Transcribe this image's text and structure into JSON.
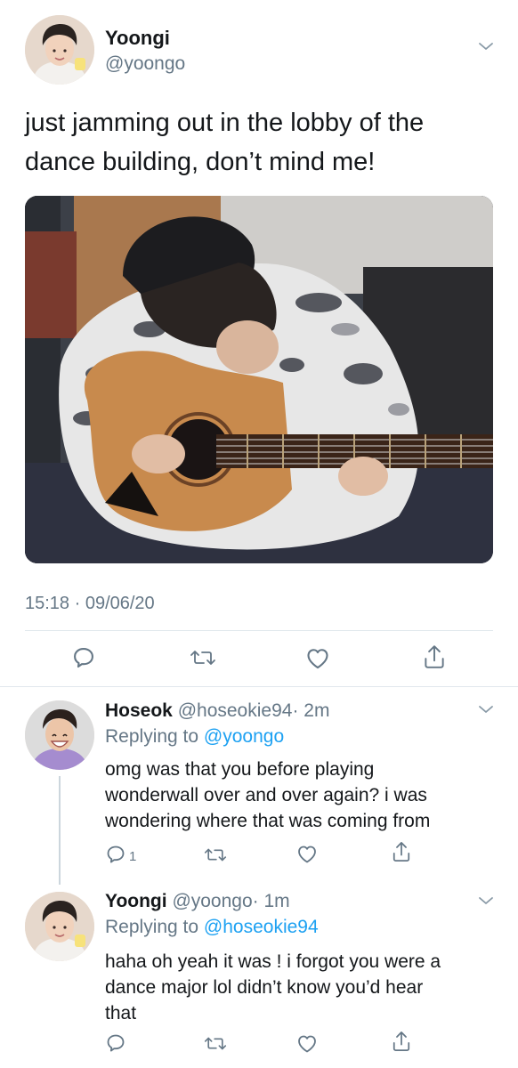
{
  "main_tweet": {
    "display_name": "Yoongi",
    "handle": "@yoongo",
    "text_line1": "just jamming out in the lobby of the",
    "text_line2": "dance building, don’t mind me!",
    "timestamp": "15:18 · 09/06/20",
    "avatar_icon": "person-avatar",
    "media_icon": "photo-guitar-player"
  },
  "replies": [
    {
      "display_name": "Hoseok",
      "handle": "@hoseokie94",
      "time": "· 2m",
      "replying_label": "Replying to",
      "replying_to": "@yoongo",
      "text_line1": "omg was that you before playing",
      "text_line2": "wonderwall over and over again? i was",
      "text_line3": "wondering where that was coming from",
      "reply_count": "1"
    },
    {
      "display_name": "Yoongi",
      "handle": "@yoongo",
      "time": "· 1m",
      "replying_label": "Replying to",
      "replying_to": "@hoseokie94",
      "text_line1": "haha oh yeah it was ! i forgot you were a",
      "text_line2": "dance major lol didn’t know you’d hear",
      "text_line3": "that"
    }
  ],
  "icons": {
    "reply": "reply-icon",
    "retweet": "retweet-icon",
    "like": "heart-icon",
    "share": "share-icon",
    "more": "chevron-down-icon"
  },
  "colors": {
    "link": "#1da1f2",
    "muted": "#657786",
    "text": "#14171a",
    "divider": "#e1e8ed"
  }
}
